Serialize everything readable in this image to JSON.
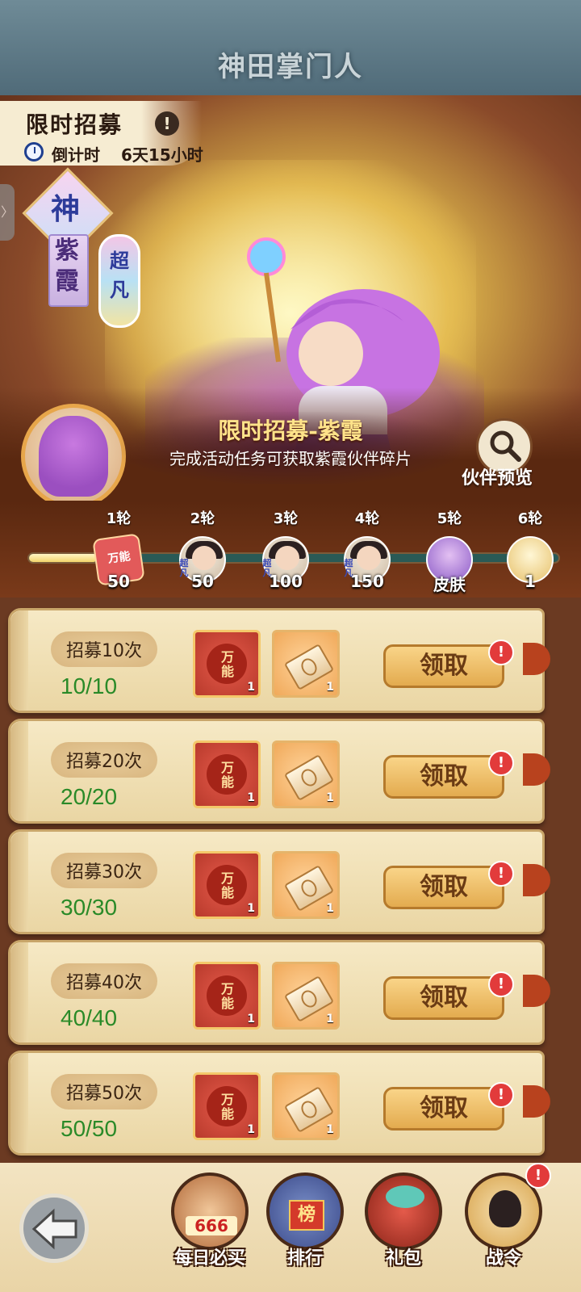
{
  "header": {
    "logo_text": "神田掌门人"
  },
  "event": {
    "title": "限时招募",
    "info_symbol": "!",
    "countdown_label": "倒计时",
    "countdown_value": "6天15小时",
    "side_tab_symbol": "〉",
    "rank": "神",
    "character_name": "紫霞",
    "tier": "超凡",
    "subtitle": "限时招募-紫霞",
    "description": "完成活动任务可获取紫霞伙伴碎片",
    "preview_label": "伙伴预览"
  },
  "milestones": {
    "progress": 0.13,
    "rounds": [
      {
        "label": "1轮",
        "value": "50",
        "kind": "card",
        "tag": "万能"
      },
      {
        "label": "2轮",
        "value": "50",
        "kind": "hero",
        "tag": "超凡"
      },
      {
        "label": "3轮",
        "value": "100",
        "kind": "hero",
        "tag": "超凡"
      },
      {
        "label": "4轮",
        "value": "150",
        "kind": "hero",
        "tag": "超凡"
      },
      {
        "label": "5轮",
        "value": "皮肤",
        "kind": "skin",
        "tag": ""
      },
      {
        "label": "6轮",
        "value": "1",
        "kind": "gold",
        "tag": ""
      }
    ]
  },
  "tasks": [
    {
      "label": "招募10次",
      "progress": "10/10",
      "reward1_text": "万能",
      "reward1_count": "1",
      "reward2_count": "1",
      "claim_label": "领取",
      "badge": "!"
    },
    {
      "label": "招募20次",
      "progress": "20/20",
      "reward1_text": "万能",
      "reward1_count": "1",
      "reward2_count": "1",
      "claim_label": "领取",
      "badge": "!"
    },
    {
      "label": "招募30次",
      "progress": "30/30",
      "reward1_text": "万能",
      "reward1_count": "1",
      "reward2_count": "1",
      "claim_label": "领取",
      "badge": "!"
    },
    {
      "label": "招募40次",
      "progress": "40/40",
      "reward1_text": "万能",
      "reward1_count": "1",
      "reward2_count": "1",
      "claim_label": "领取",
      "badge": "!"
    },
    {
      "label": "招募50次",
      "progress": "50/50",
      "reward1_text": "万能",
      "reward1_count": "1",
      "reward2_count": "1",
      "claim_label": "领取",
      "badge": "!"
    }
  ],
  "nav": {
    "daily_label": "每日必买",
    "daily_digits": "666",
    "ranking_label": "排行",
    "ranking_sign": "榜",
    "gift_label": "礼包",
    "battle_label": "战令",
    "battle_badge": "!"
  },
  "colors": {
    "progress_green": "#2a8a28",
    "badge_red": "#e23b3b",
    "claim_gold": "#e3ab4f"
  }
}
